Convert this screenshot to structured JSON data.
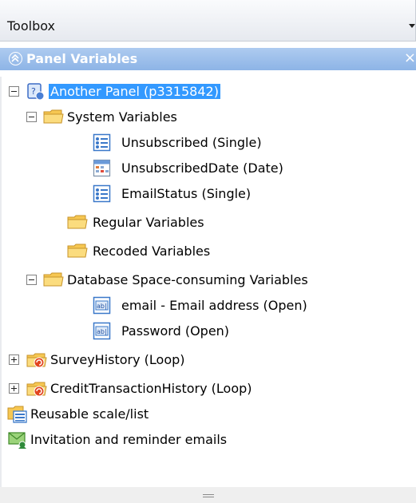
{
  "toolbox": {
    "title": "Toolbox"
  },
  "panel": {
    "title": "Panel Variables"
  },
  "tree": {
    "root": {
      "label": "Another Panel (p3315842)",
      "icon": "panel-icon"
    },
    "system_variables": {
      "label": "System Variables",
      "icon": "folder-icon"
    },
    "unsubscribed": {
      "label": "Unsubscribed (Single)",
      "icon": "single-choice-icon"
    },
    "unsubscribed_date": {
      "label": "UnsubscribedDate (Date)",
      "icon": "date-icon"
    },
    "email_status": {
      "label": "EmailStatus (Single)",
      "icon": "single-choice-icon"
    },
    "regular_variables": {
      "label": "Regular Variables",
      "icon": "folder-icon"
    },
    "recoded_variables": {
      "label": "Recoded Variables",
      "icon": "folder-icon"
    },
    "database_variables": {
      "label": "Database Space-consuming Variables",
      "icon": "folder-icon"
    },
    "email": {
      "label": "email - Email address (Open)",
      "icon": "open-text-icon"
    },
    "password": {
      "label": "Password (Open)",
      "icon": "open-text-icon"
    },
    "survey_history": {
      "label": "SurveyHistory (Loop)",
      "icon": "loop-folder-icon"
    },
    "credit_history": {
      "label": "CreditTransactionHistory (Loop)",
      "icon": "loop-folder-icon"
    },
    "reusable": {
      "label": "Reusable scale/list",
      "icon": "reusable-list-icon"
    },
    "invitation": {
      "label": "Invitation and reminder emails",
      "icon": "email-icon"
    }
  },
  "colors": {
    "selection": "#3399ff",
    "panel_header": "#9dbfeb",
    "folder": "#f6c752"
  }
}
